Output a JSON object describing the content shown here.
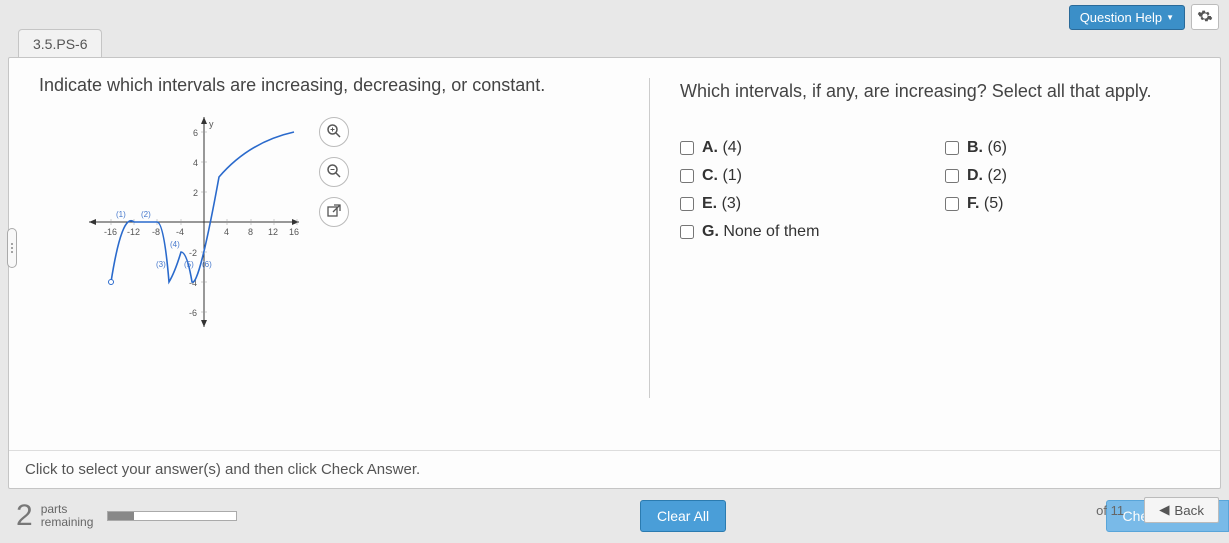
{
  "header": {
    "question_help": "Question Help"
  },
  "tab": {
    "label": "3.5.PS-6"
  },
  "left": {
    "prompt": "Indicate which intervals are increasing, decreasing, or constant."
  },
  "right": {
    "prompt": "Which intervals, if any, are increasing? Select all that apply.",
    "options": {
      "A": "(4)",
      "B": "(6)",
      "C": "(1)",
      "D": "(2)",
      "E": "(3)",
      "F": "(5)",
      "G": "None of them"
    }
  },
  "graph": {
    "ylabel": "y",
    "x_ticks": [
      "-16",
      "-12",
      "-8",
      "-4",
      "4",
      "8",
      "12",
      "16"
    ],
    "y_ticks": [
      "6",
      "4",
      "2",
      "-2",
      "-4",
      "-6"
    ],
    "segments": [
      "(1)",
      "(2)",
      "(3)",
      "(4)",
      "(5)",
      "(6)"
    ]
  },
  "instruction": "Click to select your answer(s) and then click Check Answer.",
  "footer": {
    "parts_count": "2",
    "parts_line1": "parts",
    "parts_line2": "remaining",
    "clear": "Clear All",
    "check": "Check Answer"
  },
  "bottom": {
    "of_total": "of 11",
    "back": "Back"
  },
  "chart_data": {
    "type": "line",
    "title": "",
    "xlabel": "",
    "ylabel": "y",
    "xlim": [
      -18,
      18
    ],
    "ylim": [
      -7,
      7
    ],
    "segments": [
      {
        "name": "(1)",
        "direction": "increasing",
        "from": [
          -16,
          -4
        ],
        "to": [
          -12,
          0
        ]
      },
      {
        "name": "(2)",
        "direction": "constant",
        "from": [
          -12,
          0
        ],
        "to": [
          -8,
          0
        ]
      },
      {
        "name": "(3)",
        "direction": "decreasing",
        "from": [
          -8,
          0
        ],
        "to": [
          -6,
          -4
        ]
      },
      {
        "name": "(4)",
        "direction": "increasing",
        "from": [
          -6,
          -4
        ],
        "to": [
          -4,
          -2
        ]
      },
      {
        "name": "(5)",
        "direction": "decreasing",
        "from": [
          -4,
          -2
        ],
        "to": [
          -2,
          -4
        ]
      },
      {
        "name": "(6)",
        "direction": "increasing",
        "from": [
          -2,
          -4
        ],
        "to": [
          16,
          6
        ]
      }
    ]
  }
}
